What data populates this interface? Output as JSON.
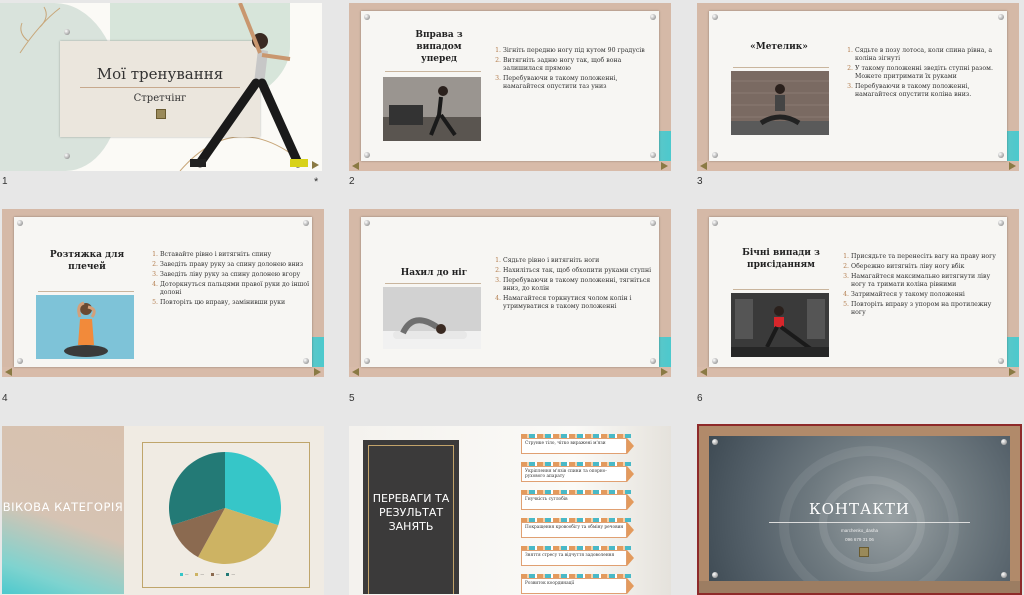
{
  "slides": [
    {
      "number": "1",
      "title": "Мої тренування",
      "subtitle": "Стретчінг",
      "star": "*"
    },
    {
      "number": "2",
      "title": "Вправа з випадом уперед",
      "steps": [
        "Зігніть передню ногу під кутом 90 градусів",
        "Витягніть задню ногу так, щоб вона залишилася прямою",
        "Перебуваючи в такому положенні, намагайтеся опустити таз униз"
      ]
    },
    {
      "number": "3",
      "title": "«Метелик»",
      "steps": [
        "Сядьте в позу лотоса, коли спина рівна, а коліна зігнуті",
        "У такому положенні зведіть ступні разом. Можете притримати їх руками",
        "Перебуваючи в такому положенні, намагайтеся опустити коліна вниз."
      ]
    },
    {
      "number": "4",
      "title": "Розтяжка для плечей",
      "steps": [
        "Вставайте рівно і витягніть спину",
        "Заведіть праву руку за спину долонею вниз",
        "Заведіть ліву руку за спину долонею вгору",
        "Доторкнуться пальцями правої руки до іншої долоні",
        "Повторіть цю вправу, замінивши руки"
      ]
    },
    {
      "number": "5",
      "title": "Нахил до ніг",
      "steps": [
        "Сядьте рівно і витягніть ноги",
        "Нахиліться так, щоб обхопити руками ступні",
        "Перебуваючи в такому положенні, тягніться вниз, до колін",
        "Намагайтеся торкнутися чолом колін і утримуватися в такому положенні"
      ]
    },
    {
      "number": "6",
      "title": "Бічні випади з присіданням",
      "steps": [
        "Присядьте та перенесіть вагу на праву ногу",
        "Обережно витягніть ліву ногу вбік",
        "Намагайтеся максимально витягнути ліву ногу та тримати коліна рівними",
        "Затримайтеся у такому положенні",
        "Повторіть вправу з упором на протилежну ногу"
      ]
    },
    {
      "number": "",
      "title": "ВІКОВА КАТЕГОРІЯ"
    },
    {
      "number": "",
      "title": "ПЕРЕВАГИ ТА РЕЗУЛЬТАТ ЗАНЯТЬ",
      "items": [
        "Струнке тіло, чітко виражені м'язи",
        "Укріплення м'язів спини та опорно-рухового апарату",
        "Гнучкість суглобів",
        "Покращення кровообігу та обміну речовин",
        "Зняття стресу та відчуття задоволення",
        "Розвиток координації"
      ]
    },
    {
      "number": "",
      "title": "КОНТАКТИ",
      "contact_name": "marchenko_dasha",
      "phone": "096 679 31 06"
    }
  ],
  "chart_data": {
    "type": "pie",
    "values": [
      30,
      28,
      12,
      30
    ],
    "colors": [
      "#36c6c8",
      "#cdb363",
      "#8b6a50",
      "#237a76"
    ]
  },
  "colors": {
    "canvas": "#e7e7e7",
    "frame_tan": "#d5b9a7",
    "accent_teal": "#4cc9cd"
  }
}
